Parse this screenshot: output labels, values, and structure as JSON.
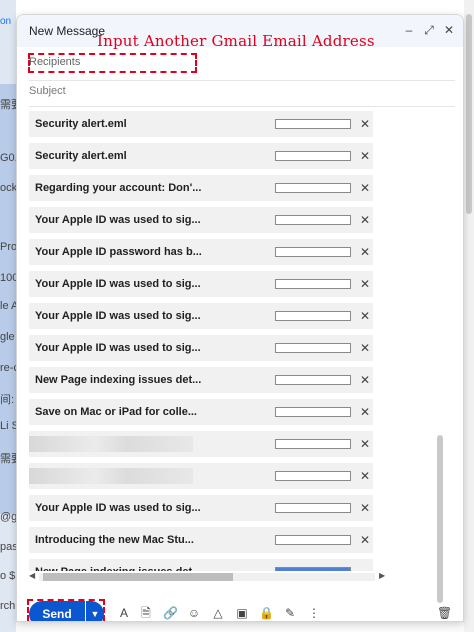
{
  "background": {
    "fragments": [
      "on",
      "需要",
      "G0.",
      "ocku",
      "Pro",
      "100",
      "le A",
      "gle",
      "re-c",
      "间:",
      "Li S",
      "需要",
      "@g",
      "pas",
      "o $1",
      "rch"
    ]
  },
  "compose": {
    "title": "New Message",
    "header_icons": {
      "minimize": "–",
      "expand": "⤢",
      "close": "✕"
    },
    "recipients_placeholder": "Recipients",
    "subject_placeholder": "Subject",
    "annotation": "Input Another Gmail Email Address",
    "attachments": [
      {
        "name": "Security alert.eml",
        "progress": 0
      },
      {
        "name": "Security alert.eml",
        "progress": 0
      },
      {
        "name": "Regarding your account: Don'...",
        "progress": 0
      },
      {
        "name": "Your Apple ID was used to sig...",
        "progress": 0
      },
      {
        "name": "Your Apple ID password has b...",
        "progress": 0
      },
      {
        "name": "Your Apple ID was used to sig...",
        "progress": 0
      },
      {
        "name": "Your Apple ID was used to sig...",
        "progress": 0
      },
      {
        "name": "Your Apple ID was used to sig...",
        "progress": 0
      },
      {
        "name": "New Page indexing issues det...",
        "progress": 0
      },
      {
        "name": "Save on Mac or iPad for colle...",
        "progress": 0
      },
      {
        "name": "",
        "progress": 0,
        "redacted": true
      },
      {
        "name": "",
        "progress": 0,
        "redacted": true
      },
      {
        "name": "Your Apple ID was used to sig...",
        "progress": 0
      },
      {
        "name": "Introducing the new Mac Stu...",
        "progress": 0
      },
      {
        "name": "New Page indexing issues det...",
        "progress": 1.0
      }
    ],
    "remove_glyph": "✕",
    "send_label": "Send",
    "send_more_glyph": "▼",
    "toolbar_icons": [
      {
        "name": "formatting-icon",
        "glyph": "A"
      },
      {
        "name": "attach-file-icon",
        "glyph": "🗎"
      },
      {
        "name": "insert-link-icon",
        "glyph": "🔗"
      },
      {
        "name": "emoji-icon",
        "glyph": "☺"
      },
      {
        "name": "drive-icon",
        "glyph": "△"
      },
      {
        "name": "insert-photo-icon",
        "glyph": "▣"
      },
      {
        "name": "confidential-mode-icon",
        "glyph": "🔒"
      },
      {
        "name": "signature-icon",
        "glyph": "✎"
      },
      {
        "name": "more-options-icon",
        "glyph": "⋮"
      }
    ],
    "discard_icon": "🗑"
  },
  "colors": {
    "accent": "#0b57d0",
    "annotation": "#e0001b",
    "progress_fill": "#4f7fd6"
  }
}
